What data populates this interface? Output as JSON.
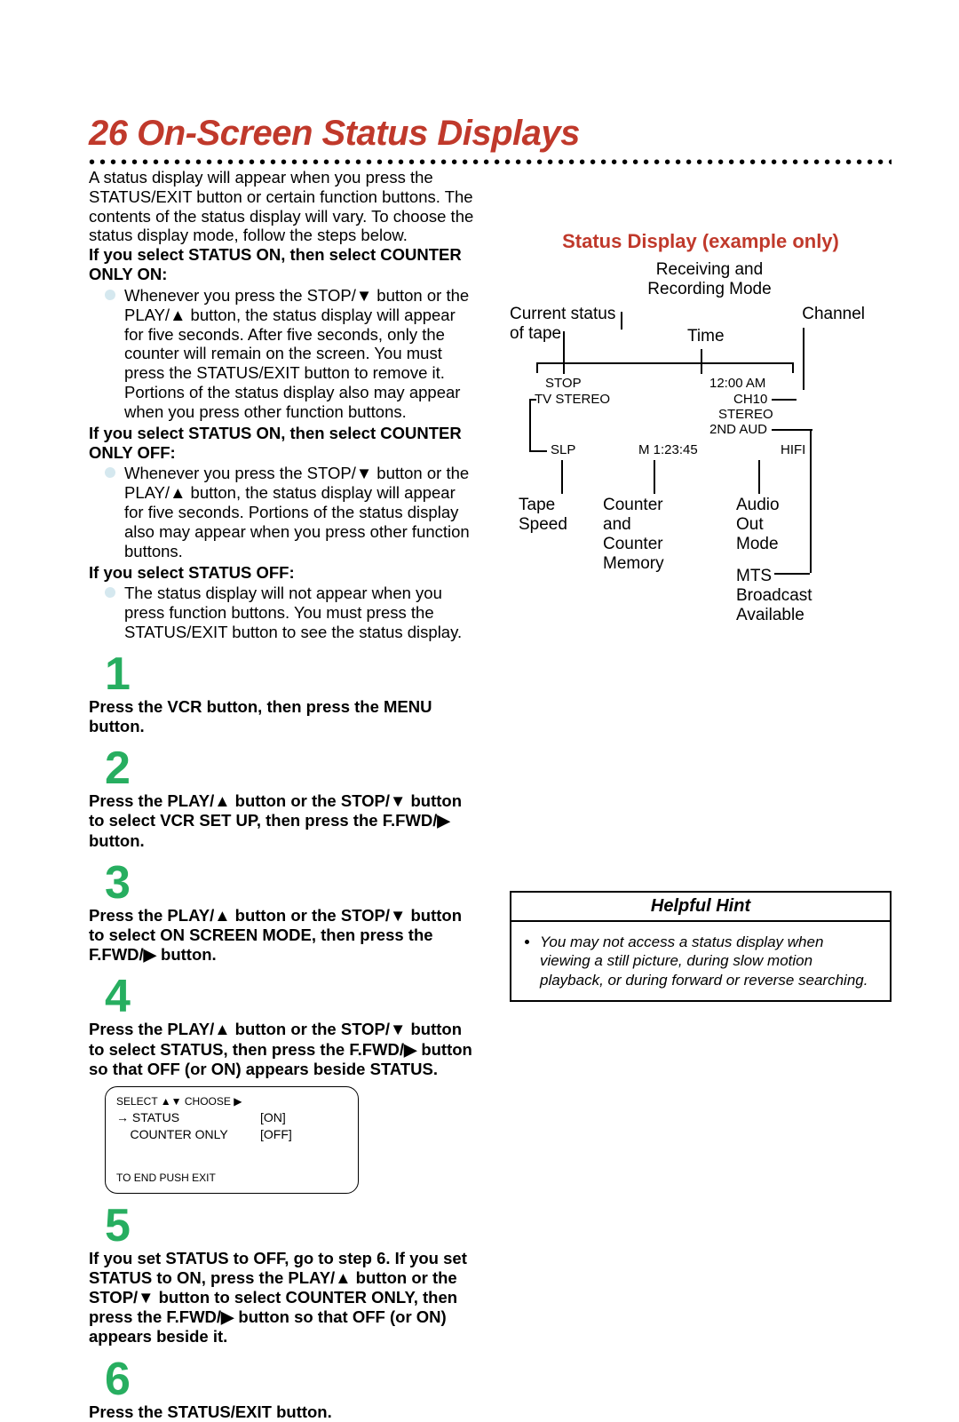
{
  "title": "26  On-Screen Status Displays",
  "intro": "A status display will appear when you press the STATUS/EXIT button or certain function buttons. The contents of the status display will vary. To choose the status display mode, follow the steps below.",
  "blocks": [
    {
      "head": "If you select STATUS ON, then select COUNTER ONLY ON:",
      "body": "Whenever you press the STOP/▼ button or the PLAY/▲ button, the status display will appear for five seconds. After five seconds, only the counter will remain on the screen. You must press the STATUS/EXIT button to remove it. Portions of the status display also may appear when you press other function buttons."
    },
    {
      "head": "If you select STATUS ON, then select COUNTER ONLY OFF:",
      "body": "Whenever you press the STOP/▼ button or the PLAY/▲ button, the status display will appear for five seconds. Portions of the status display also may appear when you press other function buttons."
    },
    {
      "head": "If you select STATUS OFF:",
      "body": "The status display will not appear when you press function buttons. You must press the STATUS/EXIT button to see the status display."
    }
  ],
  "steps": {
    "s1": "Press the VCR button, then press the MENU button.",
    "s2": "Press the PLAY/▲ button or the STOP/▼ button to select VCR SET UP, then press the F.FWD/▶ button.",
    "s3": "Press the PLAY/▲ button or the STOP/▼ button to select ON SCREEN MODE, then press the F.FWD/▶ button.",
    "s4": "Press the PLAY/▲ button or the STOP/▼ button to select STATUS, then press the F.FWD/▶ button so that OFF (or ON) appears beside STATUS.",
    "s5": "If you set STATUS to OFF, go to step 6. If you set STATUS to ON, press the PLAY/▲ button or the STOP/▼ button to select COUNTER ONLY, then press the F.FWD/▶ button so that OFF (or ON) appears beside it.",
    "s6": "Press the STATUS/EXIT button."
  },
  "menu": {
    "head": "SELECT ▲▼ CHOOSE ▶",
    "rows": [
      [
        "→ STATUS",
        "[ON]"
      ],
      [
        "    COUNTER ONLY",
        "[OFF]"
      ]
    ],
    "foot": "TO END  PUSH EXIT"
  },
  "status": {
    "title": "Status Display (example only)",
    "labels": {
      "receiving": "Receiving and Recording Mode",
      "current": "Current status of tape",
      "channel": "Channel",
      "time": "Time",
      "tapespeed": "Tape Speed",
      "counter": "Counter and Counter Memory",
      "audio": "Audio Out Mode",
      "mts": "MTS Broadcast Available"
    },
    "osd": {
      "stop": "STOP",
      "tvstereo": "TV STEREO",
      "clock": "12:00 AM",
      "ch": "CH10",
      "stereo": "STEREO",
      "aud": "2ND AUD",
      "slp": "SLP",
      "m": "M  1:23:45",
      "hifi": "HIFI"
    }
  },
  "hint": {
    "title": "Helpful Hint",
    "body": "You may not access a status display when viewing a still picture, during slow motion playback, or during forward or reverse searching."
  }
}
